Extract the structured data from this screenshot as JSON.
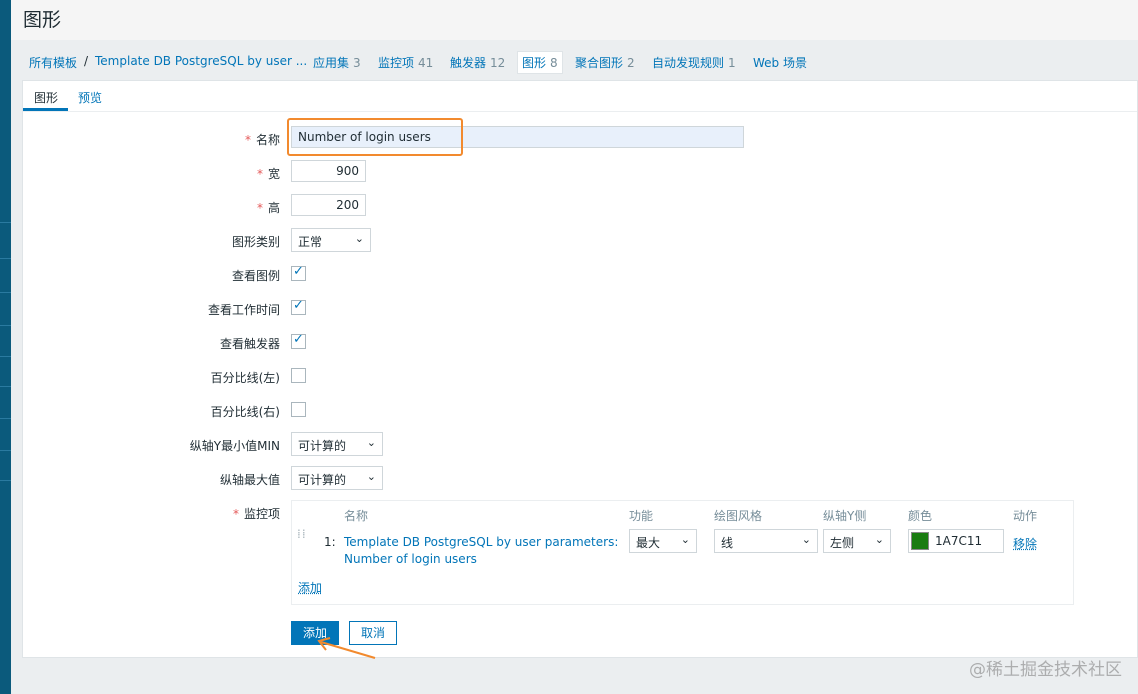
{
  "page": {
    "title": "图形"
  },
  "breadcrumb": {
    "all_templates": "所有模板",
    "separator": "/",
    "template_name": "Template DB PostgreSQL by user ..."
  },
  "subnav": [
    {
      "label": "应用集",
      "count": "3"
    },
    {
      "label": "监控项",
      "count": "41"
    },
    {
      "label": "触发器",
      "count": "12"
    },
    {
      "label": "图形",
      "count": "8",
      "active": true
    },
    {
      "label": "聚合图形",
      "count": "2"
    },
    {
      "label": "自动发现规则",
      "count": "1"
    },
    {
      "label": "Web 场景",
      "count": ""
    }
  ],
  "tabs": {
    "graph": "图形",
    "preview": "预览"
  },
  "form": {
    "name_label": "名称",
    "name_value": "Number of login users",
    "width_label": "宽",
    "width_value": "900",
    "height_label": "高",
    "height_value": "200",
    "graph_type_label": "图形类别",
    "graph_type_value": "正常",
    "show_legend_label": "查看图例",
    "show_legend": true,
    "show_working_time_label": "查看工作时间",
    "show_working_time": true,
    "show_triggers_label": "查看触发器",
    "show_triggers": true,
    "percentile_left_label": "百分比线(左)",
    "percentile_left": false,
    "percentile_right_label": "百分比线(右)",
    "percentile_right": false,
    "ymin_label": "纵轴Y最小值MIN",
    "ymin_value": "可计算的",
    "ymax_label": "纵轴最大值",
    "ymax_value": "可计算的",
    "items_label": "监控项"
  },
  "items_table": {
    "headers": {
      "name": "名称",
      "function": "功能",
      "draw_style": "绘图风格",
      "y_side": "纵轴Y侧",
      "color": "颜色",
      "action": "动作"
    },
    "rows": [
      {
        "index": "1:",
        "name_line1": "Template DB PostgreSQL by user parameters:",
        "name_line2": "Number of login users",
        "function": "最大",
        "draw_style": "线",
        "y_side": "左侧",
        "color": "1A7C11",
        "color_hex": "#1A7C11",
        "action": "移除"
      }
    ],
    "add_link": "添加"
  },
  "buttons": {
    "add": "添加",
    "cancel": "取消"
  },
  "watermark": "@稀土掘金技术社区",
  "colors": {
    "accent": "#0275b8",
    "required": "#e45959",
    "highlight": "#f28a2e"
  }
}
